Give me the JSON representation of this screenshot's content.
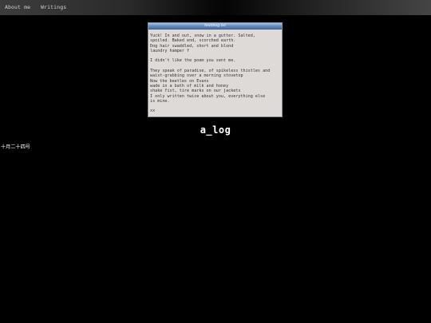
{
  "nav": {
    "items": [
      {
        "label": "About me"
      },
      {
        "label": "Writings"
      }
    ]
  },
  "window": {
    "title": "textblog.txt",
    "body_lines": [
      "Yuck! In and out, snow in a gutter. Salted,",
      "spoiled. Baked end, scorched earth.",
      "Dog hair swaddled, short and blond",
      "laundry hamper f",
      "",
      "I didn't like the poem you sent me.",
      "",
      "They speak of paradise, of spikeless thistles and",
      "waist-grabbing over a morning stovetop",
      "Now the beetles on Evans",
      "wade in a bath of milk and honey",
      "shake fist, tire marks on our jackets",
      "I only written twice about you, everything else",
      "is mine.",
      "",
      "xx"
    ]
  },
  "site": {
    "title": "a_log"
  },
  "post": {
    "date": "十月二十四号"
  }
}
